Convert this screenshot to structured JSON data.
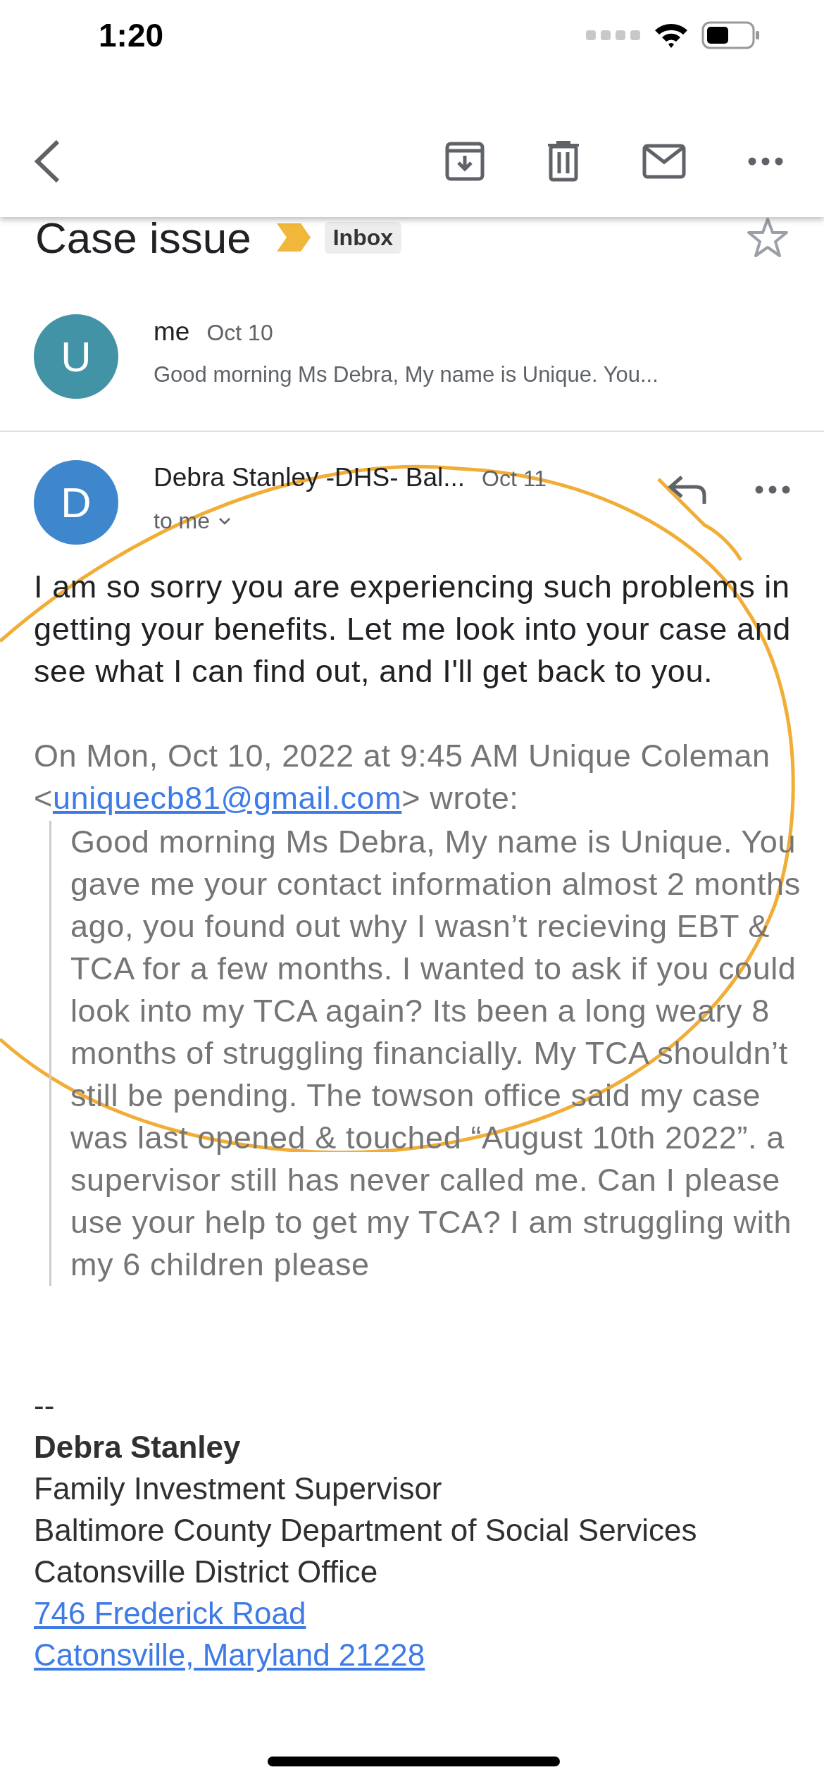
{
  "status_bar": {
    "time": "1:20"
  },
  "subject": {
    "title": "Case issue",
    "label": "Inbox",
    "starred": false
  },
  "messages": [
    {
      "avatar": "U",
      "color": "#4293a6",
      "sender": "me",
      "date": "Oct 10",
      "preview": "Good morning Ms Debra, My name is Unique. You..."
    },
    {
      "avatar": "D",
      "color": "#3f87cd",
      "sender": "Debra Stanley -DHS- Bal...",
      "date": "Oct 11",
      "recipient": "to me"
    }
  ],
  "body": "I am so sorry you are experiencing such problems in getting your benefits. Let me look into your case and see what I can find out, and I'll get back to you.",
  "quote_header": {
    "before": "On Mon, Oct 10, 2022 at 9:45 AM Unique Coleman <",
    "email": "uniquecb81@gmail.com",
    "after": "> wrote:"
  },
  "quote": "Good morning Ms Debra, My name is Unique. You gave me your contact information almost 2 months ago, you found out why I wasn’t recieving EBT & TCA for a few months. I wanted to ask if you could look into my TCA again? Its been a long weary 8 months of struggling financially. My TCA shouldn’t still be pending. The towson office said my case was last opened & touched “August 10th 2022”. a supervisor still has never called me. Can I please use your help to get my TCA? I am struggling with my 6 children please",
  "signature": {
    "separator": "--",
    "name": "Debra Stanley",
    "lines": [
      "Family Investment Supervisor",
      "Baltimore County Department of Social Services",
      "Catonsville District Office"
    ],
    "links": [
      "746 Frederick Road",
      "Catonsville, Maryland  21228"
    ]
  }
}
